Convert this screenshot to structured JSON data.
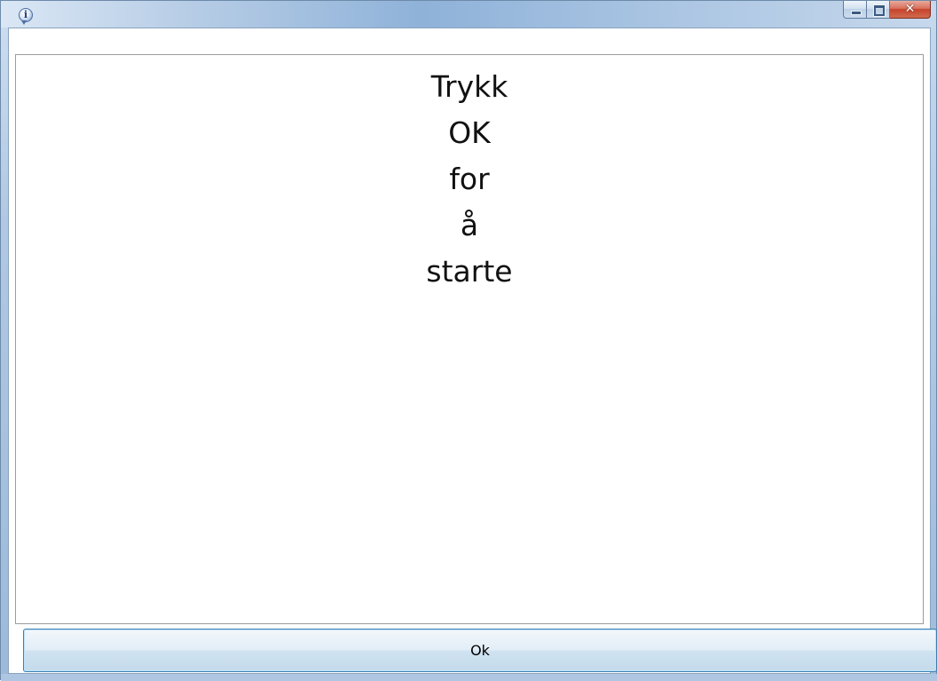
{
  "window": {
    "title": "",
    "icon": "info-icon",
    "icon_glyph": "i",
    "caption_buttons": {
      "minimize_icon": "minimize-icon",
      "maximize_icon": "maximize-icon",
      "close_icon": "close-icon",
      "close_glyph": "✕"
    },
    "colors": {
      "close_button": "#c7432b",
      "ok_button_border": "#3c7fb1"
    }
  },
  "message": {
    "lines": [
      "Trykk",
      "OK",
      "for",
      "å",
      "starte"
    ]
  },
  "ok_button": {
    "label": "Ok"
  }
}
